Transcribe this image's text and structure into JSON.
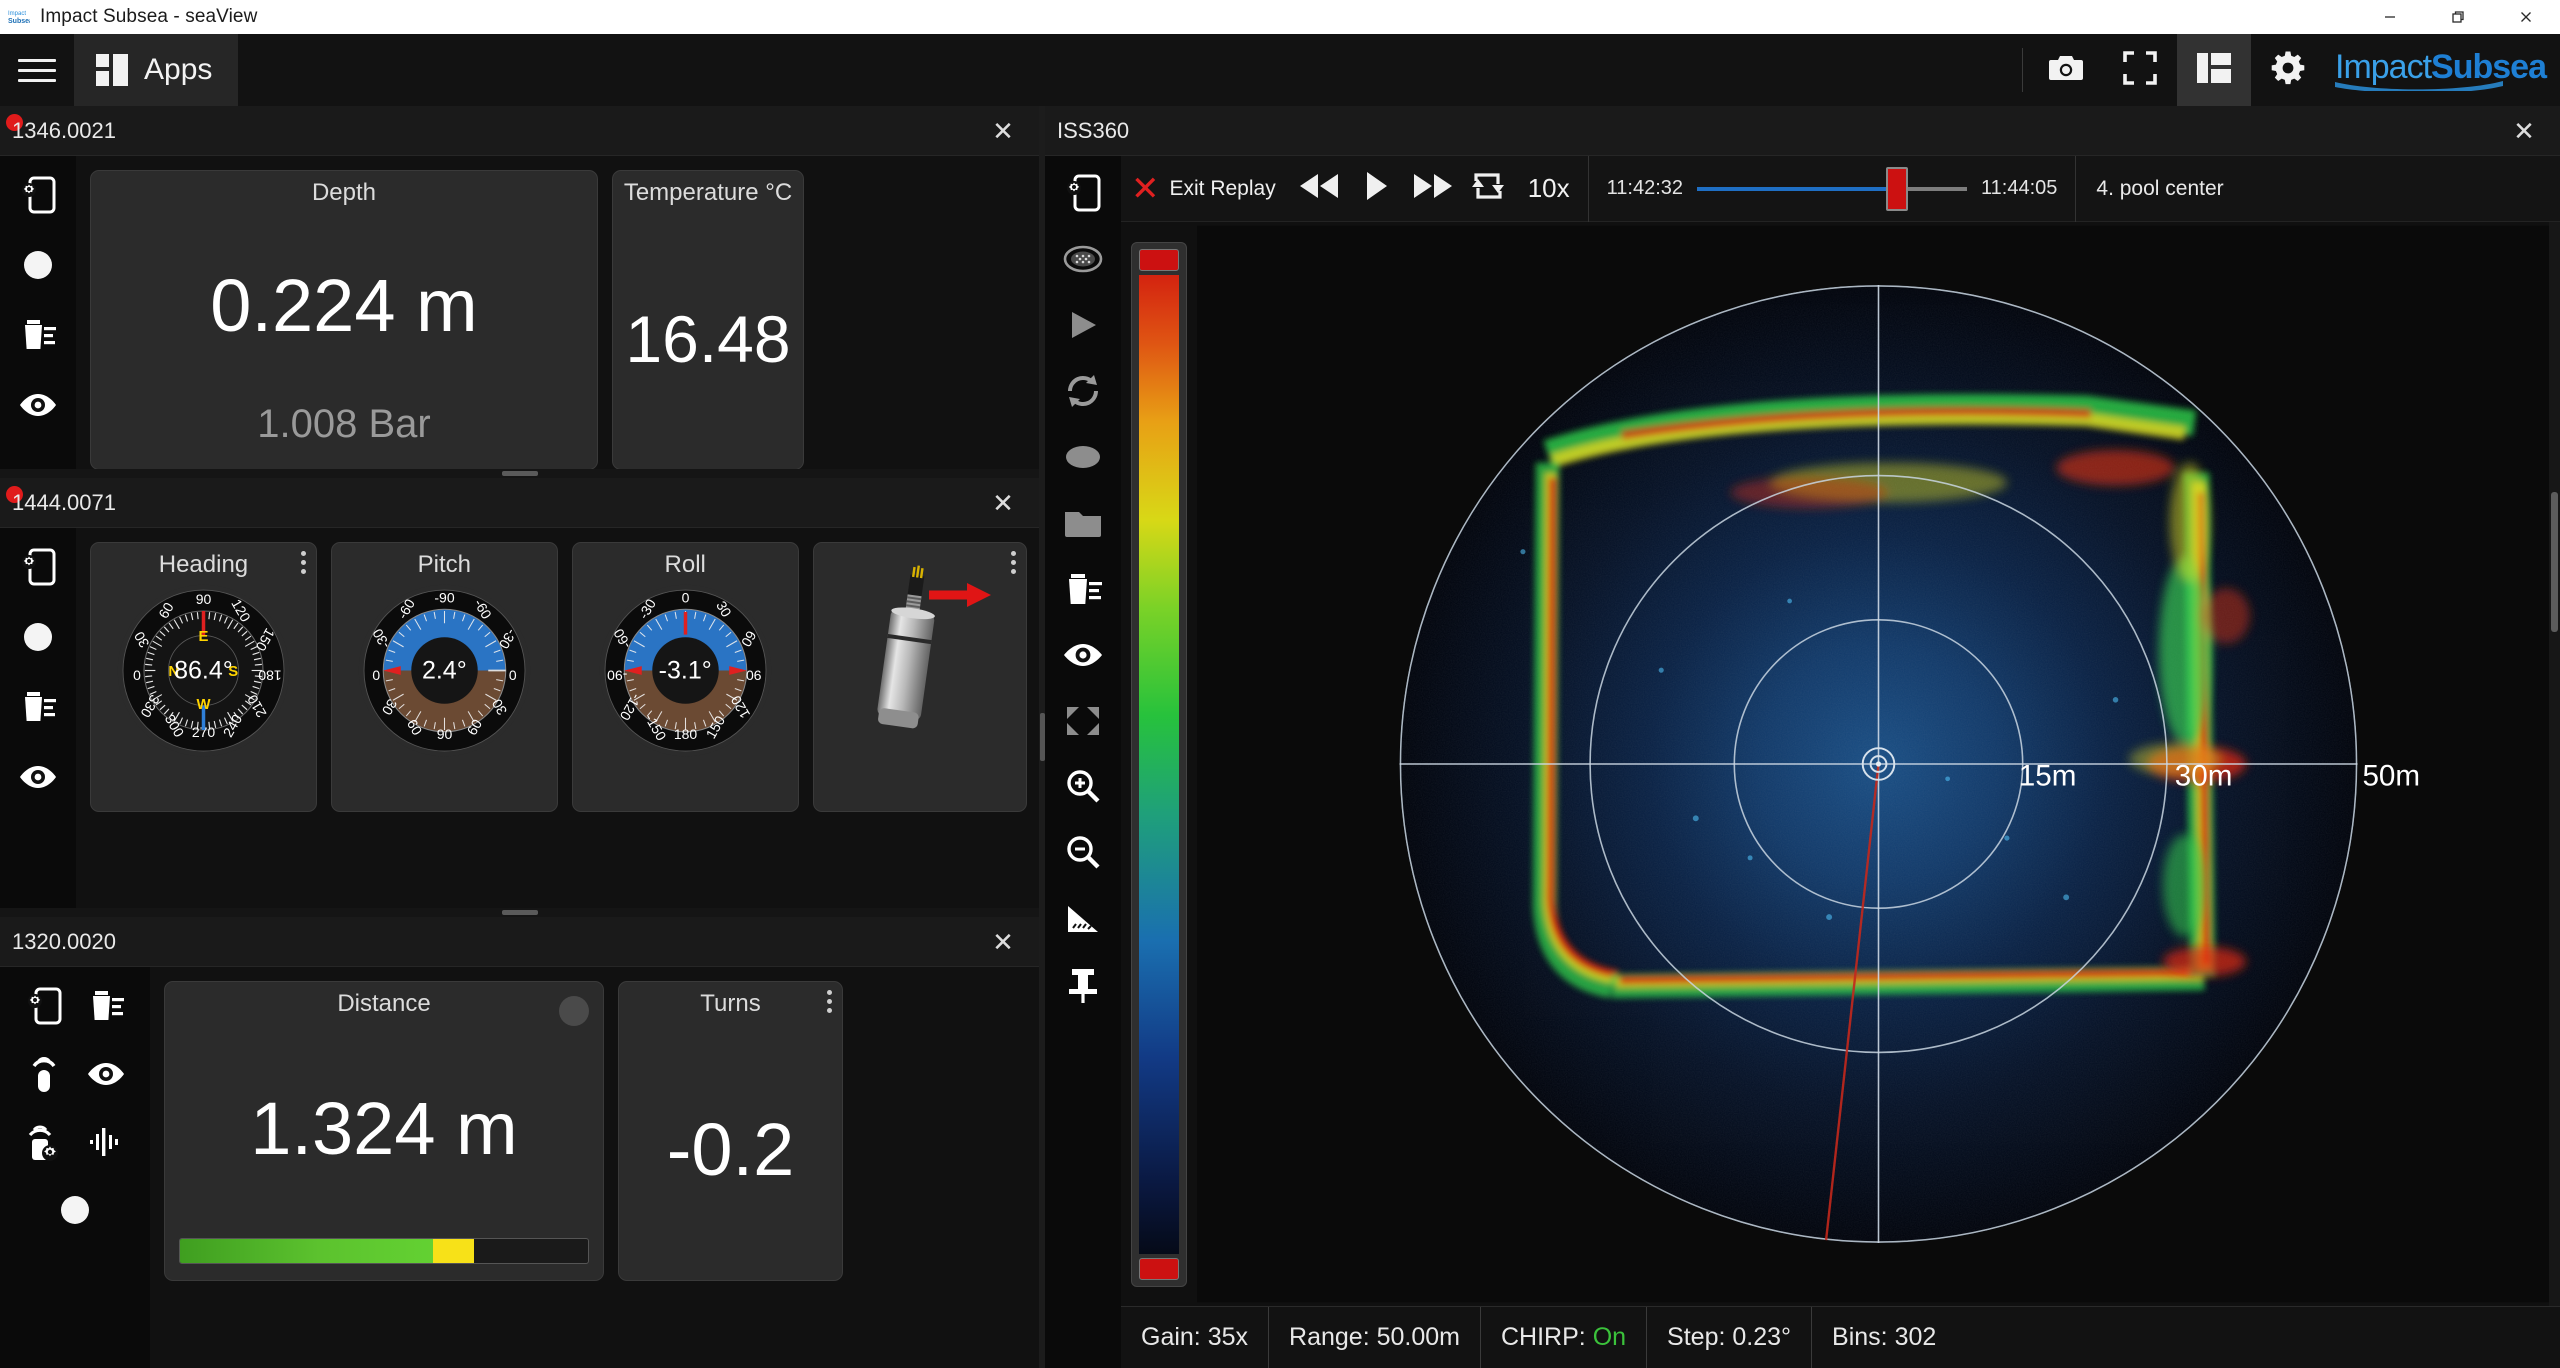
{
  "window": {
    "title": "Impact Subsea - seaView",
    "app_icon": "impact-subsea-logo-icon",
    "minimize": "—",
    "maximize": "❐",
    "close": "✕"
  },
  "appbar": {
    "menu_icon": "hamburger-menu-icon",
    "apps_icon": "apps-grid-icon",
    "apps_label": "Apps",
    "tools": [
      {
        "name": "camera-snapshot-icon",
        "label": "Snapshot",
        "active": false
      },
      {
        "name": "fullscreen-icon",
        "label": "Full Screen",
        "active": false
      },
      {
        "name": "layout-icon",
        "label": "Layout",
        "active": true
      },
      {
        "name": "gear-settings-icon",
        "label": "Settings",
        "active": false
      }
    ],
    "brand_part1": "Impact",
    "brand_part2": "Subsea",
    "brand_accent": "#2a8fdb"
  },
  "panels": {
    "depth": {
      "id": "1346.0021",
      "recording": true,
      "close_label": "✕",
      "rail_icons": [
        "device-settings-icon",
        "record-circle-icon",
        "log-delete-icon",
        "eye-visibility-icon"
      ],
      "cards": [
        {
          "title": "Depth",
          "value": "0.224 m",
          "sub": "1.008 Bar"
        },
        {
          "title": "Temperature °C",
          "value": "16.48",
          "sub": ""
        }
      ]
    },
    "ahrs": {
      "id": "1444.0071",
      "recording": true,
      "close_label": "✕",
      "rail_icons": [
        "device-settings-icon",
        "record-circle-icon",
        "log-delete-icon",
        "eye-visibility-icon"
      ],
      "gauges": [
        {
          "title": "Heading",
          "value": "86.4°",
          "kebab": true,
          "type": "compass",
          "ticks": [
            "0",
            "30",
            "60",
            "90",
            "120",
            "150",
            "180",
            "210",
            "240",
            "270",
            "300",
            "330"
          ],
          "cardinals": [
            "N",
            "E",
            "S",
            "W"
          ]
        },
        {
          "title": "Pitch",
          "value": "2.4°",
          "kebab": false,
          "type": "attitude",
          "ticks": [
            "0",
            "-30",
            "-60",
            "-90",
            "-60",
            "-30",
            "0",
            "30",
            "60",
            "90",
            "60",
            "30"
          ]
        },
        {
          "title": "Roll",
          "value": "-3.1°",
          "kebab": false,
          "type": "attitude",
          "ticks": [
            "0",
            "30",
            "60",
            "90",
            "120",
            "150",
            "180",
            "-150",
            "-120",
            "-90",
            "-60",
            "-30"
          ]
        }
      ],
      "attitude_card": {
        "icon": "sensor-3d-model-icon",
        "arrow": "heading-arrow-icon",
        "kebab": true
      }
    },
    "altimeter": {
      "id": "1320.0020",
      "recording": false,
      "close_label": "✕",
      "rail_icons": [
        "device-settings-icon",
        "log-delete-icon",
        "sonar-signal-icon",
        "eye-visibility-icon",
        "sonar-settings-icon",
        "waveform-icon",
        "record-circle-icon"
      ],
      "cards": [
        {
          "title": "Distance",
          "value": "1.324 m",
          "has_circle_button": true,
          "progress_green_pct": 62,
          "progress_yellow_pct": 10
        },
        {
          "title": "Turns",
          "value": "-0.2",
          "kebab": true
        }
      ]
    }
  },
  "sonar": {
    "title": "ISS360",
    "close_label": "✕",
    "rail_icons": [
      "device-settings-icon",
      "sonar-head-icon",
      "play-icon",
      "continuous-scan-icon",
      "record-circle-icon",
      "folder-open-icon",
      "log-delete-icon",
      "eye-visibility-icon",
      "fit-screen-icon",
      "zoom-in-icon",
      "zoom-out-icon",
      "measure-icon",
      "pin-icon"
    ],
    "replay": {
      "settings_icon": "gear-settings-icon",
      "exit_icon": "close-x-icon",
      "exit_label": "Exit Replay",
      "rewind_icon": "rewind-icon",
      "play_icon": "play-icon",
      "forward_icon": "fast-forward-icon",
      "loop_icon": "loop-repeat-icon",
      "speed": "10x",
      "time_start": "11:42:32",
      "time_end": "11:44:05",
      "progress_pct": 70,
      "file_label": "4. pool center"
    },
    "display": {
      "range_labels": [
        "15m",
        "30m",
        "50m"
      ],
      "range_fractions": [
        0.3,
        0.6,
        1.0
      ],
      "center_marker": "sonar-origin-icon",
      "cursor_line_color": "#c22",
      "ring_color": "#c9d6e2",
      "background": "#04070f"
    },
    "colorbar": {
      "top_cap_color": "#cc1111",
      "bottom_cap_color": "#cc1111",
      "gradient_low": "#050a18",
      "gradient_high": "#d42310"
    },
    "status": [
      {
        "label": "Gain:",
        "value": "35x"
      },
      {
        "label": "Range:",
        "value": "50.00m"
      },
      {
        "label": "CHIRP:",
        "value": "On",
        "value_color": "#3bc23b"
      },
      {
        "label": "Step:",
        "value": "0.23°"
      },
      {
        "label": "Bins:",
        "value": "302"
      }
    ]
  }
}
